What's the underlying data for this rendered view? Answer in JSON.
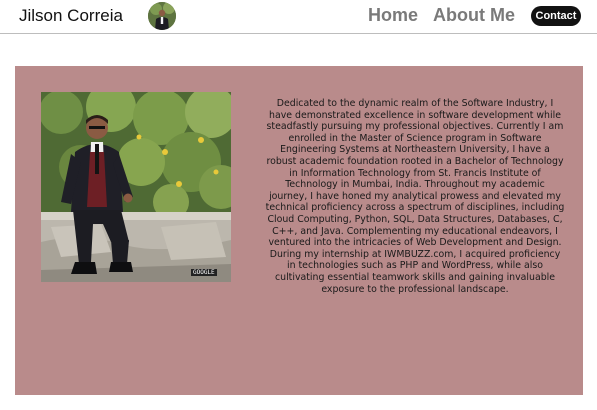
{
  "header": {
    "brand": "Jilson Correia",
    "nav": {
      "home": "Home",
      "about": "About Me",
      "contact": "Contact"
    }
  },
  "about": {
    "photo_caption": "GOOGLE",
    "bio": "Dedicated to the dynamic realm of the Software Industry, I have demonstrated excellence in software development while steadfastly pursuing my professional objectives. Currently I am enrolled in the Master of Science program in Software Engineering Systems at Northeastern University, I have a robust academic foundation rooted in a Bachelor of Technology in Information Technology from St. Francis Institute of Technology in Mumbai, India. Throughout my academic journey, I have honed my analytical prowess and elevated my technical proficiency across a spectrum of disciplines, including Cloud Computing, Python, SQL, Data Structures, Databases, C, C++, and Java. Complementing my educational endeavors, I ventured into the intricacies of Web Development and Design. During my internship at IWMBUZZ.com, I acquired proficiency in technologies such as PHP and WordPress, while also cultivating essential teamwork skills and gaining invaluable exposure to the professional landscape."
  },
  "colors": {
    "card_background": "#b98b8b",
    "contact_button": "#121212",
    "nav_link": "#7a7a7a"
  }
}
